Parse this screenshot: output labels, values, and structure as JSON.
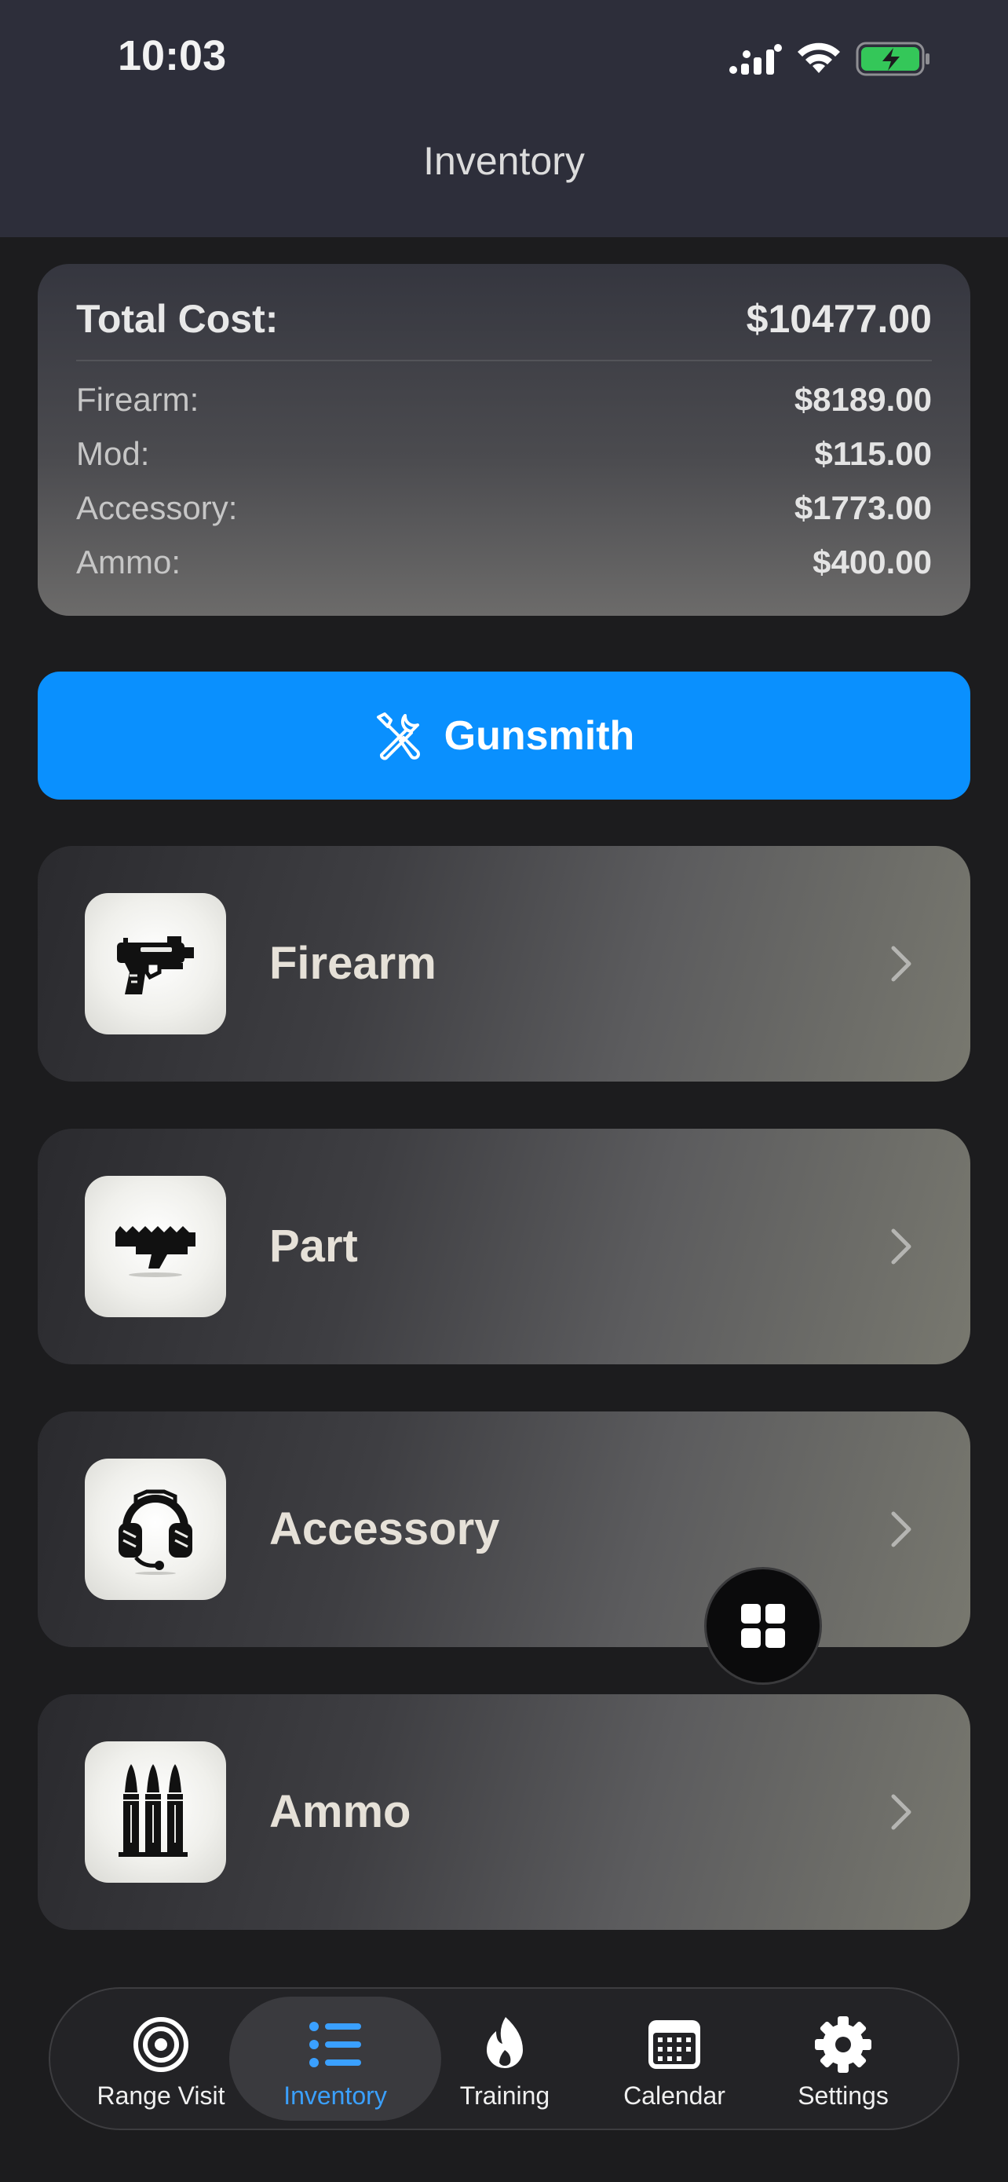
{
  "status_bar": {
    "time": "10:03"
  },
  "nav": {
    "title": "Inventory"
  },
  "summary": {
    "total_label": "Total Cost:",
    "total_value": "$10477.00",
    "rows": [
      {
        "label": "Firearm:",
        "value": "$8189.00"
      },
      {
        "label": "Mod:",
        "value": "$115.00"
      },
      {
        "label": "Accessory:",
        "value": "$1773.00"
      },
      {
        "label": "Ammo:",
        "value": "$400.00"
      }
    ]
  },
  "gunsmith": {
    "label": "Gunsmith",
    "icon": "wrench-screwdriver-icon"
  },
  "categories": [
    {
      "label": "Firearm",
      "icon": "pistol-icon"
    },
    {
      "label": "Part",
      "icon": "rail-part-icon"
    },
    {
      "label": "Accessory",
      "icon": "headset-icon"
    },
    {
      "label": "Ammo",
      "icon": "bullets-icon"
    }
  ],
  "fab": {
    "icon": "grid-icon"
  },
  "tabs": [
    {
      "label": "Range Visit",
      "icon": "target-icon",
      "active": false
    },
    {
      "label": "Inventory",
      "icon": "list-icon",
      "active": true
    },
    {
      "label": "Training",
      "icon": "flame-icon",
      "active": false
    },
    {
      "label": "Calendar",
      "icon": "calendar-icon",
      "active": false
    },
    {
      "label": "Settings",
      "icon": "gear-icon",
      "active": false
    }
  ],
  "colors": {
    "accent": "#0a90fe",
    "active_tab": "#3aa0ff",
    "battery": "#34c759"
  }
}
